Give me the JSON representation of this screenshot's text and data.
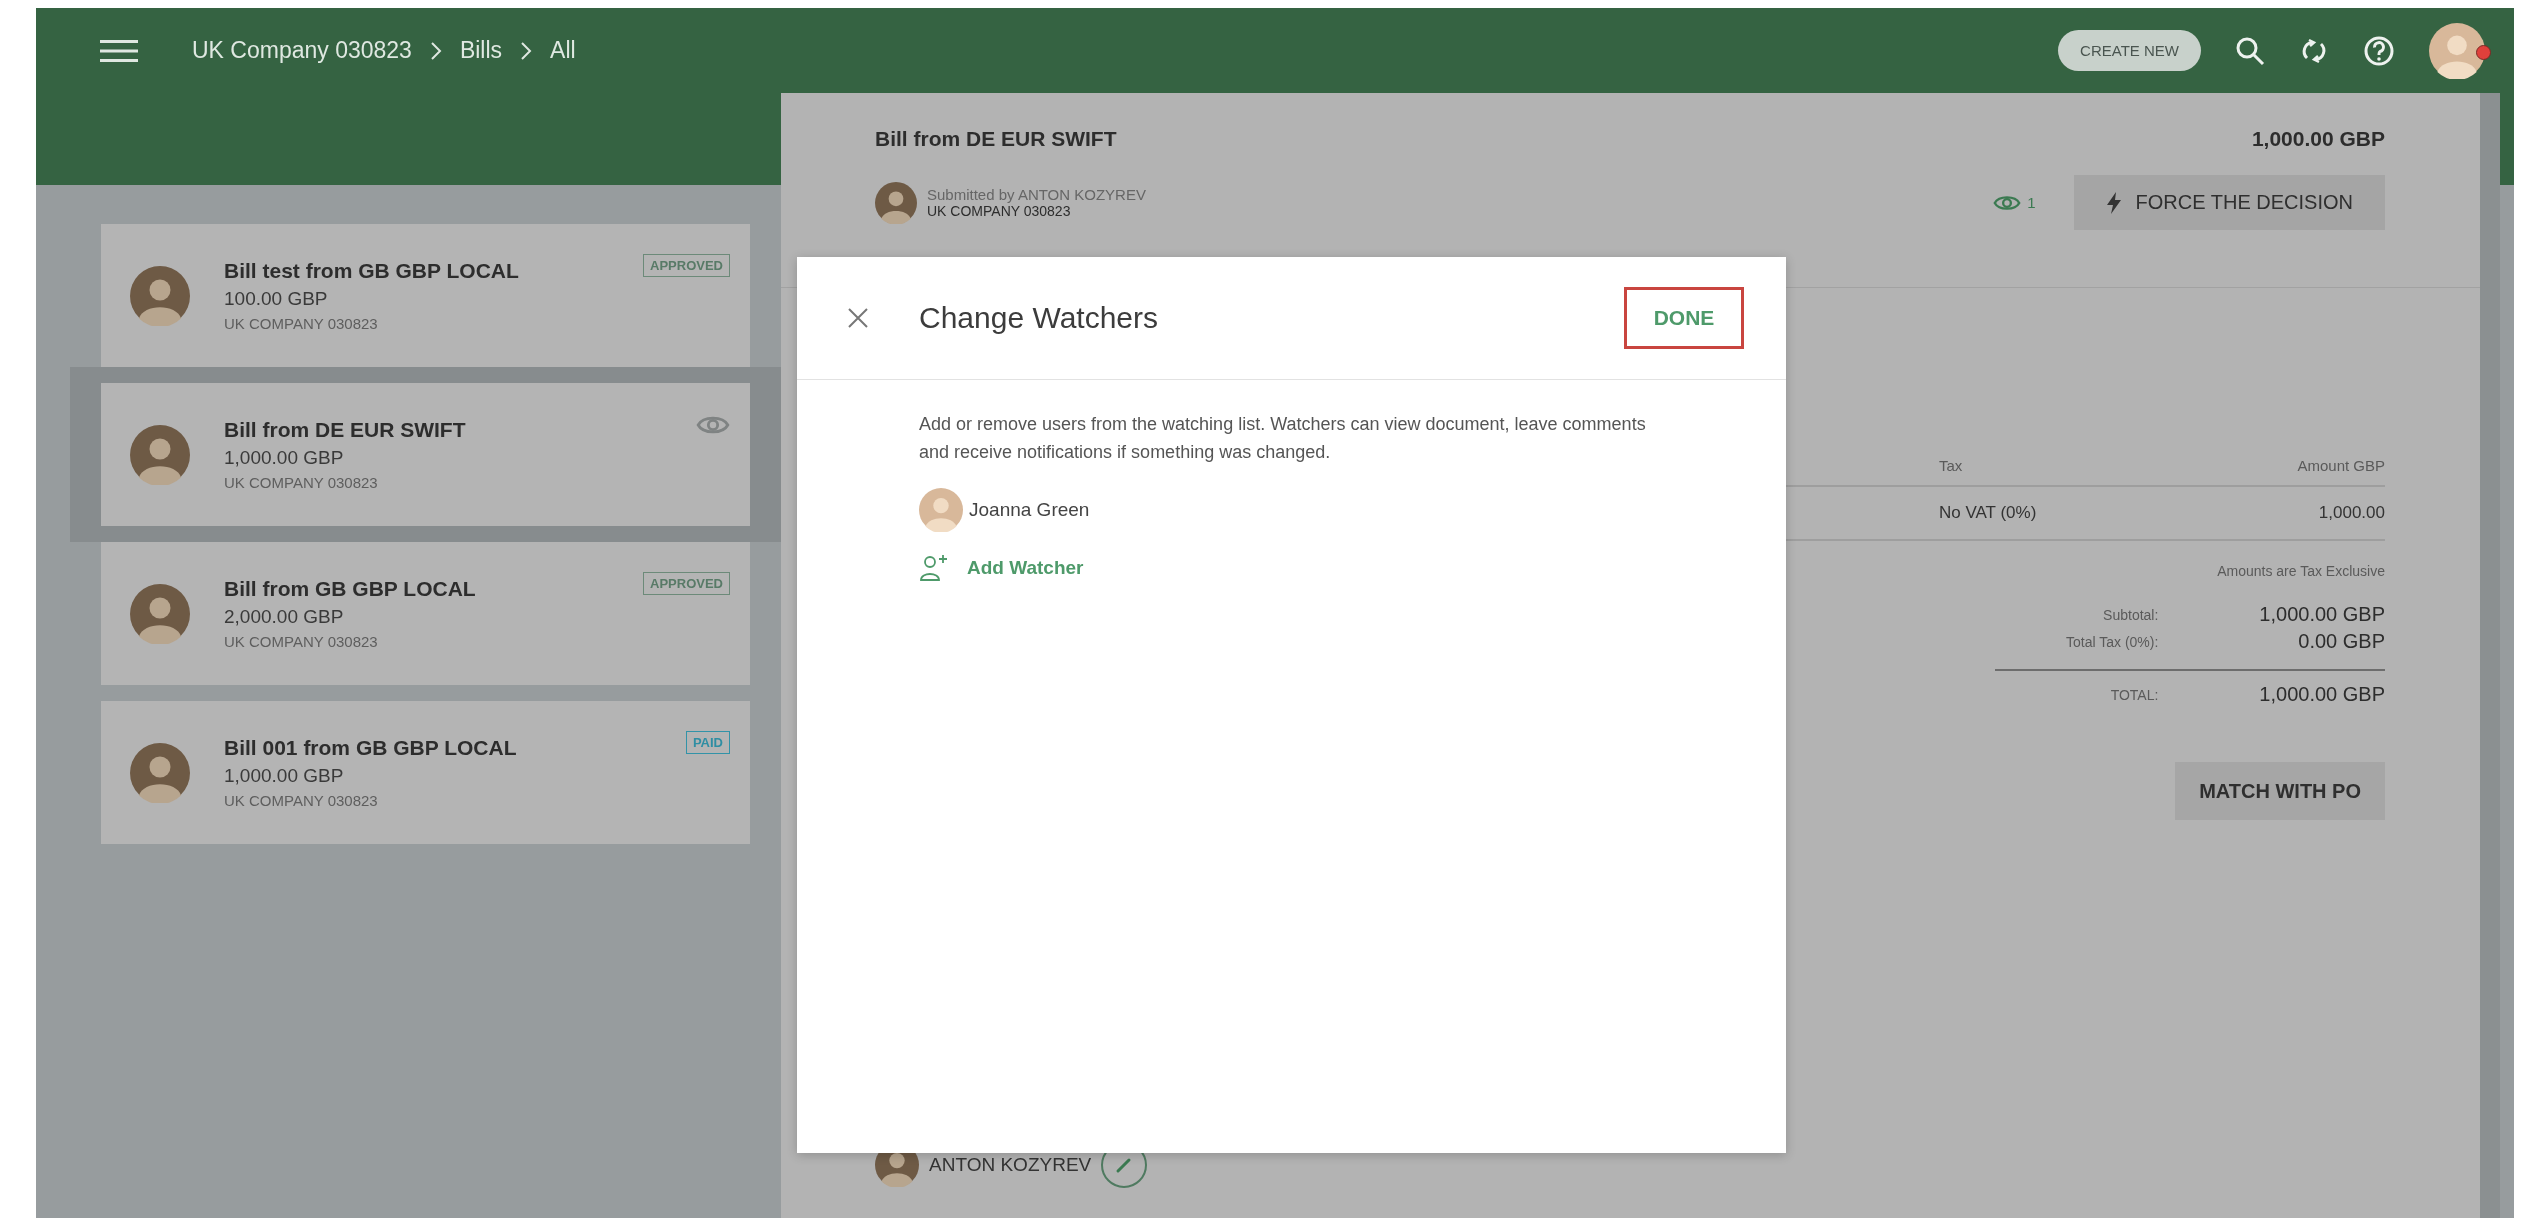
{
  "topbar": {
    "breadcrumb": [
      "UK Company 030823",
      "Bills",
      "All"
    ],
    "create_button": "CREATE NEW",
    "has_notification": true
  },
  "bills": [
    {
      "title": "Bill test from GB GBP LOCAL",
      "amount": "100.00 GBP",
      "company": "UK COMPANY 030823",
      "badge": {
        "label": "APPROVED",
        "kind": "approved"
      },
      "watched": false,
      "selected": false
    },
    {
      "title": "Bill from DE EUR SWIFT",
      "amount": "1,000.00 GBP",
      "company": "UK COMPANY 030823",
      "watched": true,
      "selected": true
    },
    {
      "title": "Bill from GB GBP LOCAL",
      "amount": "2,000.00 GBP",
      "company": "UK COMPANY 030823",
      "badge": {
        "label": "APPROVED",
        "kind": "approved"
      },
      "watched": false,
      "selected": false
    },
    {
      "title": "Bill 001 from GB GBP LOCAL",
      "amount": "1,000.00 GBP",
      "company": "UK COMPANY 030823",
      "badge": {
        "label": "PAID",
        "kind": "paid"
      },
      "watched": false,
      "selected": false
    }
  ],
  "detail": {
    "title": "Bill from DE EUR SWIFT",
    "amount": "1,000.00 GBP",
    "submitted_by": "Submitted by ANTON KOZYREV",
    "company": "UK COMPANY 030823",
    "watchers_count": "1",
    "force_button": "FORCE THE DECISION",
    "tax_table": {
      "columns": [
        "Tax",
        "Amount GBP"
      ],
      "rows": [
        [
          "No VAT (0%)",
          "1,000.00"
        ]
      ]
    },
    "tax_note": "Amounts are Tax Exclusive",
    "totals": [
      {
        "label": "Subtotal:",
        "value": "1,000.00 GBP",
        "kind": "sub"
      },
      {
        "label": "Total Tax (0%):",
        "value": "0.00 GBP",
        "kind": "sub"
      },
      {
        "label": "TOTAL:",
        "value": "1,000.00 GBP",
        "kind": "grand"
      }
    ],
    "match_button": "MATCH WITH PO",
    "approver": "ANTON KOZYREV"
  },
  "modal": {
    "title": "Change Watchers",
    "done_button": "DONE",
    "done_highlighted": true,
    "description": "Add or remove users from the watching list. Watchers can view document, leave comments and receive notifications if something was changed.",
    "watchers": [
      {
        "name": "Joanna Green"
      }
    ],
    "add_link": "Add Watcher"
  }
}
